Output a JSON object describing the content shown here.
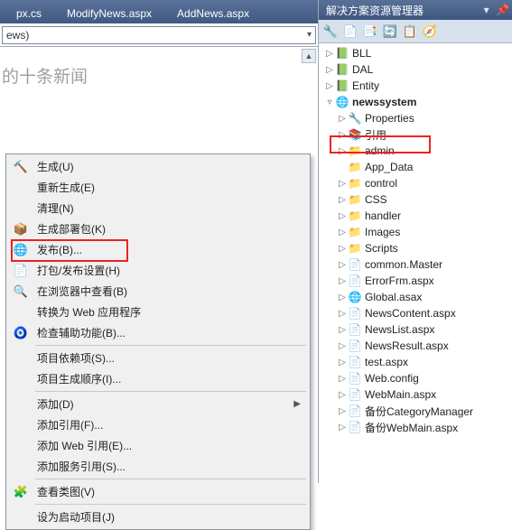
{
  "tabs": {
    "items": [
      {
        "label": "px.cs"
      },
      {
        "label": "ModifyNews.aspx"
      },
      {
        "label": "AddNews.aspx"
      }
    ]
  },
  "dropdown": {
    "value": "ews)"
  },
  "editor": {
    "placeholder_text": "的十条新闻"
  },
  "context_menu": {
    "items": [
      {
        "icon": "build-icon",
        "glyph": "🔨",
        "label": "生成(U)",
        "arrow": false,
        "sep": false
      },
      {
        "icon": "",
        "glyph": "",
        "label": "重新生成(E)",
        "arrow": false,
        "sep": false
      },
      {
        "icon": "",
        "glyph": "",
        "label": "清理(N)",
        "arrow": false,
        "sep": false
      },
      {
        "icon": "package-icon",
        "glyph": "📦",
        "label": "生成部署包(K)",
        "arrow": false,
        "sep": false
      },
      {
        "icon": "publish-icon",
        "glyph": "🌐",
        "label": "发布(B)...",
        "arrow": false,
        "sep": false,
        "highlight": true
      },
      {
        "icon": "settings-icon",
        "glyph": "📄",
        "label": "打包/发布设置(H)",
        "arrow": false,
        "sep": false
      },
      {
        "icon": "browser-icon",
        "glyph": "🔍",
        "label": "在浏览器中查看(B)",
        "arrow": false,
        "sep": false
      },
      {
        "icon": "",
        "glyph": "",
        "label": "转换为 Web 应用程序",
        "arrow": false,
        "sep": false
      },
      {
        "icon": "accessibility-icon",
        "glyph": "🧿",
        "label": "检查辅助功能(B)...",
        "arrow": false,
        "sep": true
      },
      {
        "icon": "",
        "glyph": "",
        "label": "项目依赖项(S)...",
        "arrow": false,
        "sep": false
      },
      {
        "icon": "",
        "glyph": "",
        "label": "项目生成顺序(I)...",
        "arrow": false,
        "sep": true
      },
      {
        "icon": "",
        "glyph": "",
        "label": "添加(D)",
        "arrow": true,
        "sep": false
      },
      {
        "icon": "",
        "glyph": "",
        "label": "添加引用(F)...",
        "arrow": false,
        "sep": false
      },
      {
        "icon": "",
        "glyph": "",
        "label": "添加 Web 引用(E)...",
        "arrow": false,
        "sep": false
      },
      {
        "icon": "",
        "glyph": "",
        "label": "添加服务引用(S)...",
        "arrow": false,
        "sep": true
      },
      {
        "icon": "class-view-icon",
        "glyph": "🧩",
        "label": "查看类图(V)",
        "arrow": false,
        "sep": true
      },
      {
        "icon": "",
        "glyph": "",
        "label": "设为启动项目(J)",
        "arrow": false,
        "sep": false
      }
    ]
  },
  "solution": {
    "title": "解决方案资源管理器",
    "toolbar": [
      {
        "name": "properties-btn",
        "glyph": "🔧"
      },
      {
        "name": "show-all-btn",
        "glyph": "📄"
      },
      {
        "name": "refresh-btn",
        "glyph": "📑"
      },
      {
        "name": "sync-btn",
        "glyph": "🔄"
      },
      {
        "name": "view-btn",
        "glyph": "📋"
      },
      {
        "name": "collapse-btn",
        "glyph": "🧭"
      }
    ],
    "nodes": [
      {
        "exp": "▷",
        "kind": "proj",
        "glyph": "📗",
        "label": "BLL",
        "depth": 0
      },
      {
        "exp": "▷",
        "kind": "proj",
        "glyph": "📗",
        "label": "DAL",
        "depth": 0
      },
      {
        "exp": "▷",
        "kind": "proj",
        "glyph": "📗",
        "label": "Entity",
        "depth": 0
      },
      {
        "exp": "▿",
        "kind": "proj",
        "glyph": "🌐",
        "label": "newssystem",
        "depth": 0,
        "highlight": true,
        "bold": true
      },
      {
        "exp": "▷",
        "kind": "ref",
        "glyph": "🔧",
        "label": "Properties",
        "depth": 1
      },
      {
        "exp": "▷",
        "kind": "ref",
        "glyph": "📚",
        "label": "引用",
        "depth": 1
      },
      {
        "exp": "▷",
        "kind": "folder",
        "glyph": "📁",
        "label": "admin",
        "depth": 1
      },
      {
        "exp": "",
        "kind": "folder",
        "glyph": "📁",
        "label": "App_Data",
        "depth": 1
      },
      {
        "exp": "▷",
        "kind": "folder",
        "glyph": "📁",
        "label": "control",
        "depth": 1
      },
      {
        "exp": "▷",
        "kind": "folder",
        "glyph": "📁",
        "label": "CSS",
        "depth": 1
      },
      {
        "exp": "▷",
        "kind": "folder",
        "glyph": "📁",
        "label": "handler",
        "depth": 1
      },
      {
        "exp": "▷",
        "kind": "folder",
        "glyph": "📁",
        "label": "Images",
        "depth": 1
      },
      {
        "exp": "▷",
        "kind": "folder",
        "glyph": "📁",
        "label": "Scripts",
        "depth": 1
      },
      {
        "exp": "▷",
        "kind": "file",
        "glyph": "📄",
        "label": "common.Master",
        "depth": 1
      },
      {
        "exp": "▷",
        "kind": "file",
        "glyph": "📄",
        "label": "ErrorFrm.aspx",
        "depth": 1
      },
      {
        "exp": "▷",
        "kind": "file",
        "glyph": "🌐",
        "label": "Global.asax",
        "depth": 1
      },
      {
        "exp": "▷",
        "kind": "file",
        "glyph": "📄",
        "label": "NewsContent.aspx",
        "depth": 1
      },
      {
        "exp": "▷",
        "kind": "file",
        "glyph": "📄",
        "label": "NewsList.aspx",
        "depth": 1
      },
      {
        "exp": "▷",
        "kind": "file",
        "glyph": "📄",
        "label": "NewsResult.aspx",
        "depth": 1
      },
      {
        "exp": "▷",
        "kind": "file",
        "glyph": "📄",
        "label": "test.aspx",
        "depth": 1
      },
      {
        "exp": "▷",
        "kind": "file",
        "glyph": "📄",
        "label": "Web.config",
        "depth": 1
      },
      {
        "exp": "▷",
        "kind": "file",
        "glyph": "📄",
        "label": "WebMain.aspx",
        "depth": 1
      },
      {
        "exp": "▷",
        "kind": "file",
        "glyph": "📄",
        "label": "备份CategoryManager",
        "depth": 1
      },
      {
        "exp": "▷",
        "kind": "file",
        "glyph": "📄",
        "label": "备份WebMain.aspx",
        "depth": 1
      }
    ]
  }
}
